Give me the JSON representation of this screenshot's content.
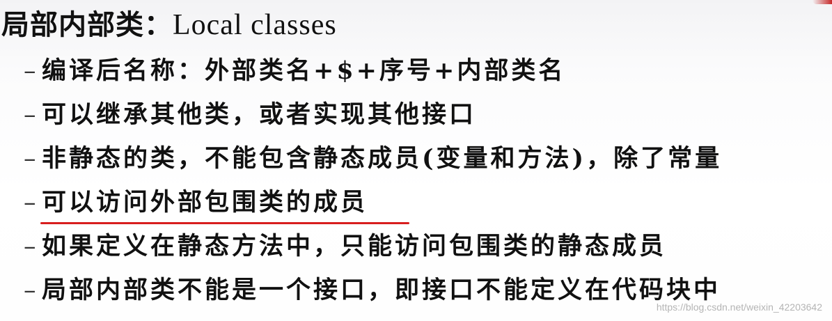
{
  "title": {
    "zh": "局部内部类：",
    "en": "Local classes"
  },
  "bullets": [
    {
      "dash": "–",
      "text": "编译后名称：外部类名+$+序号+内部类名"
    },
    {
      "dash": "–",
      "text": "可以继承其他类，或者实现其他接口"
    },
    {
      "dash": "–",
      "text": "非静态的类，不能包含静态成员(变量和方法)，除了常量"
    },
    {
      "dash": "–",
      "text": "可以访问外部包围类的成员"
    },
    {
      "dash": "–",
      "text": "如果定义在静态方法中，只能访问包围类的静态成员"
    },
    {
      "dash": "–",
      "text": "局部内部类不能是一个接口，即接口不能定义在代码块中"
    }
  ],
  "watermark": "https://blog.csdn.net/weixin_42203642",
  "colors": {
    "underline": "#d81e1e",
    "text": "#111111"
  }
}
